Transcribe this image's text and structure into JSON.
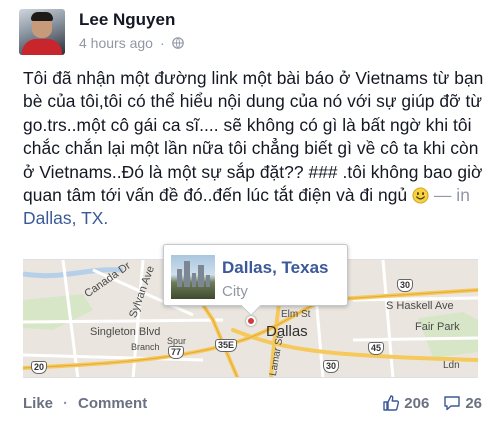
{
  "post": {
    "author": "Lee Nguyen",
    "timestamp": "4 hours ago",
    "meta_separator": "·",
    "text": "Tôi đã nhận một đường link một bài báo ở Vietnams từ bạn bè của tôi,tôi có thể hiểu nội dung của nó với sự giúp đỡ từ go.trs..một cô gái ca sĩ.... sẽ không có gì là bất ngờ khi tôi chắc chắn lại một lần nữa tôi chẳng biết gì về cô ta khi còn ở Vietnams..Đó là một sự sắp đặt?? ### .tôi không bao giờ quan tâm tới vấn đề đó..đến lúc tắt điện và đi ngủ",
    "location_prefix": "— in",
    "location_link": "Dallas, TX."
  },
  "place_card": {
    "title": "Dallas, Texas",
    "subtitle": "City"
  },
  "map": {
    "labels": {
      "canada_dr": "Canada Dr",
      "sylvan": "Sylvan Ave",
      "singleton": "Singleton Blvd",
      "branch": "Branch",
      "spur": "Spur",
      "dallas": "Dallas",
      "elm": "Elm St",
      "lamar": "S Lamar St",
      "haskell": "S Haskell Ave",
      "fair_park": "Fair Park",
      "ldn": "Ldn"
    },
    "shields": {
      "i30": "30",
      "i35e": "35E",
      "i45": "45",
      "i77": "77",
      "h30b": "30",
      "h20": "20"
    }
  },
  "actions": {
    "like": "Like",
    "separator": "·",
    "comment": "Comment"
  },
  "stats": {
    "likes": "206",
    "comments": "26"
  },
  "colors": {
    "link": "#3b5998",
    "muted": "#9197a3"
  }
}
